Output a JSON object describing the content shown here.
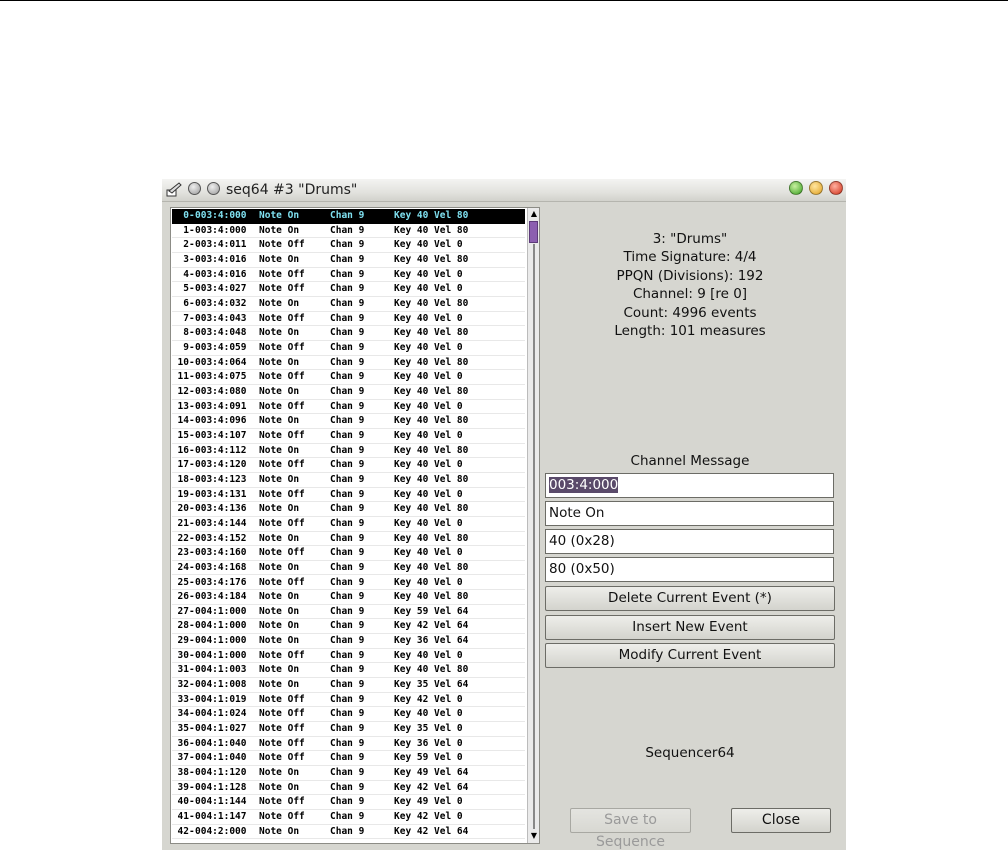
{
  "window": {
    "title": "seq64 #3 \"Drums\"",
    "colors": {
      "selected_row_bg": "#000000",
      "selected_row_text": "#7fe0f0",
      "thumb": "#8c5fb0"
    }
  },
  "events": [
    {
      "idx": "0",
      "time": "003:4:000",
      "msg": "Note On",
      "chan": "Chan 9",
      "data": "Key 40 Vel 80"
    },
    {
      "idx": "1",
      "time": "003:4:000",
      "msg": "Note On",
      "chan": "Chan 9",
      "data": "Key 40 Vel 80"
    },
    {
      "idx": "2",
      "time": "003:4:011",
      "msg": "Note Off",
      "chan": "Chan 9",
      "data": "Key 40 Vel 0"
    },
    {
      "idx": "3",
      "time": "003:4:016",
      "msg": "Note On",
      "chan": "Chan 9",
      "data": "Key 40 Vel 80"
    },
    {
      "idx": "4",
      "time": "003:4:016",
      "msg": "Note Off",
      "chan": "Chan 9",
      "data": "Key 40 Vel 0"
    },
    {
      "idx": "5",
      "time": "003:4:027",
      "msg": "Note Off",
      "chan": "Chan 9",
      "data": "Key 40 Vel 0"
    },
    {
      "idx": "6",
      "time": "003:4:032",
      "msg": "Note On",
      "chan": "Chan 9",
      "data": "Key 40 Vel 80"
    },
    {
      "idx": "7",
      "time": "003:4:043",
      "msg": "Note Off",
      "chan": "Chan 9",
      "data": "Key 40 Vel 0"
    },
    {
      "idx": "8",
      "time": "003:4:048",
      "msg": "Note On",
      "chan": "Chan 9",
      "data": "Key 40 Vel 80"
    },
    {
      "idx": "9",
      "time": "003:4:059",
      "msg": "Note Off",
      "chan": "Chan 9",
      "data": "Key 40 Vel 0"
    },
    {
      "idx": "10",
      "time": "003:4:064",
      "msg": "Note On",
      "chan": "Chan 9",
      "data": "Key 40 Vel 80"
    },
    {
      "idx": "11",
      "time": "003:4:075",
      "msg": "Note Off",
      "chan": "Chan 9",
      "data": "Key 40 Vel 0"
    },
    {
      "idx": "12",
      "time": "003:4:080",
      "msg": "Note On",
      "chan": "Chan 9",
      "data": "Key 40 Vel 80"
    },
    {
      "idx": "13",
      "time": "003:4:091",
      "msg": "Note Off",
      "chan": "Chan 9",
      "data": "Key 40 Vel 0"
    },
    {
      "idx": "14",
      "time": "003:4:096",
      "msg": "Note On",
      "chan": "Chan 9",
      "data": "Key 40 Vel 80"
    },
    {
      "idx": "15",
      "time": "003:4:107",
      "msg": "Note Off",
      "chan": "Chan 9",
      "data": "Key 40 Vel 0"
    },
    {
      "idx": "16",
      "time": "003:4:112",
      "msg": "Note On",
      "chan": "Chan 9",
      "data": "Key 40 Vel 80"
    },
    {
      "idx": "17",
      "time": "003:4:120",
      "msg": "Note Off",
      "chan": "Chan 9",
      "data": "Key 40 Vel 0"
    },
    {
      "idx": "18",
      "time": "003:4:123",
      "msg": "Note On",
      "chan": "Chan 9",
      "data": "Key 40 Vel 80"
    },
    {
      "idx": "19",
      "time": "003:4:131",
      "msg": "Note Off",
      "chan": "Chan 9",
      "data": "Key 40 Vel 0"
    },
    {
      "idx": "20",
      "time": "003:4:136",
      "msg": "Note On",
      "chan": "Chan 9",
      "data": "Key 40 Vel 80"
    },
    {
      "idx": "21",
      "time": "003:4:144",
      "msg": "Note Off",
      "chan": "Chan 9",
      "data": "Key 40 Vel 0"
    },
    {
      "idx": "22",
      "time": "003:4:152",
      "msg": "Note On",
      "chan": "Chan 9",
      "data": "Key 40 Vel 80"
    },
    {
      "idx": "23",
      "time": "003:4:160",
      "msg": "Note Off",
      "chan": "Chan 9",
      "data": "Key 40 Vel 0"
    },
    {
      "idx": "24",
      "time": "003:4:168",
      "msg": "Note On",
      "chan": "Chan 9",
      "data": "Key 40 Vel 80"
    },
    {
      "idx": "25",
      "time": "003:4:176",
      "msg": "Note Off",
      "chan": "Chan 9",
      "data": "Key 40 Vel 0"
    },
    {
      "idx": "26",
      "time": "003:4:184",
      "msg": "Note On",
      "chan": "Chan 9",
      "data": "Key 40 Vel 80"
    },
    {
      "idx": "27",
      "time": "004:1:000",
      "msg": "Note On",
      "chan": "Chan 9",
      "data": "Key 59 Vel 64"
    },
    {
      "idx": "28",
      "time": "004:1:000",
      "msg": "Note On",
      "chan": "Chan 9",
      "data": "Key 42 Vel 64"
    },
    {
      "idx": "29",
      "time": "004:1:000",
      "msg": "Note On",
      "chan": "Chan 9",
      "data": "Key 36 Vel 64"
    },
    {
      "idx": "30",
      "time": "004:1:000",
      "msg": "Note Off",
      "chan": "Chan 9",
      "data": "Key 40 Vel 0"
    },
    {
      "idx": "31",
      "time": "004:1:003",
      "msg": "Note On",
      "chan": "Chan 9",
      "data": "Key 40 Vel 80"
    },
    {
      "idx": "32",
      "time": "004:1:008",
      "msg": "Note On",
      "chan": "Chan 9",
      "data": "Key 35 Vel 64"
    },
    {
      "idx": "33",
      "time": "004:1:019",
      "msg": "Note Off",
      "chan": "Chan 9",
      "data": "Key 42 Vel 0"
    },
    {
      "idx": "34",
      "time": "004:1:024",
      "msg": "Note Off",
      "chan": "Chan 9",
      "data": "Key 40 Vel 0"
    },
    {
      "idx": "35",
      "time": "004:1:027",
      "msg": "Note Off",
      "chan": "Chan 9",
      "data": "Key 35 Vel 0"
    },
    {
      "idx": "36",
      "time": "004:1:040",
      "msg": "Note Off",
      "chan": "Chan 9",
      "data": "Key 36 Vel 0"
    },
    {
      "idx": "37",
      "time": "004:1:040",
      "msg": "Note Off",
      "chan": "Chan 9",
      "data": "Key 59 Vel 0"
    },
    {
      "idx": "38",
      "time": "004:1:120",
      "msg": "Note On",
      "chan": "Chan 9",
      "data": "Key 49 Vel 64"
    },
    {
      "idx": "39",
      "time": "004:1:128",
      "msg": "Note On",
      "chan": "Chan 9",
      "data": "Key 42 Vel 64"
    },
    {
      "idx": "40",
      "time": "004:1:144",
      "msg": "Note Off",
      "chan": "Chan 9",
      "data": "Key 49 Vel 0"
    },
    {
      "idx": "41",
      "time": "004:1:147",
      "msg": "Note Off",
      "chan": "Chan 9",
      "data": "Key 42 Vel 0"
    },
    {
      "idx": "42",
      "time": "004:2:000",
      "msg": "Note On",
      "chan": "Chan 9",
      "data": "Key 42 Vel 64"
    }
  ],
  "selected_index": 0,
  "info": {
    "name": "3: \"Drums\"",
    "time_sig": "Time Signature: 4/4",
    "ppqn": "PPQN (Divisions): 192",
    "channel": "Channel: 9 [re 0]",
    "count": "Count: 4996 events",
    "length": "Length: 101 measures"
  },
  "editor": {
    "heading": "Channel Message",
    "timestamp": "003:4:000",
    "message": "Note On",
    "data1": "40 (0x28)",
    "data2": "80 (0x50)"
  },
  "buttons": {
    "delete": "Delete Current Event (*)",
    "insert": "Insert New Event",
    "modify": "Modify Current Event",
    "save": "Save to Sequence",
    "close": "Close"
  },
  "footer_label": "Sequencer64"
}
